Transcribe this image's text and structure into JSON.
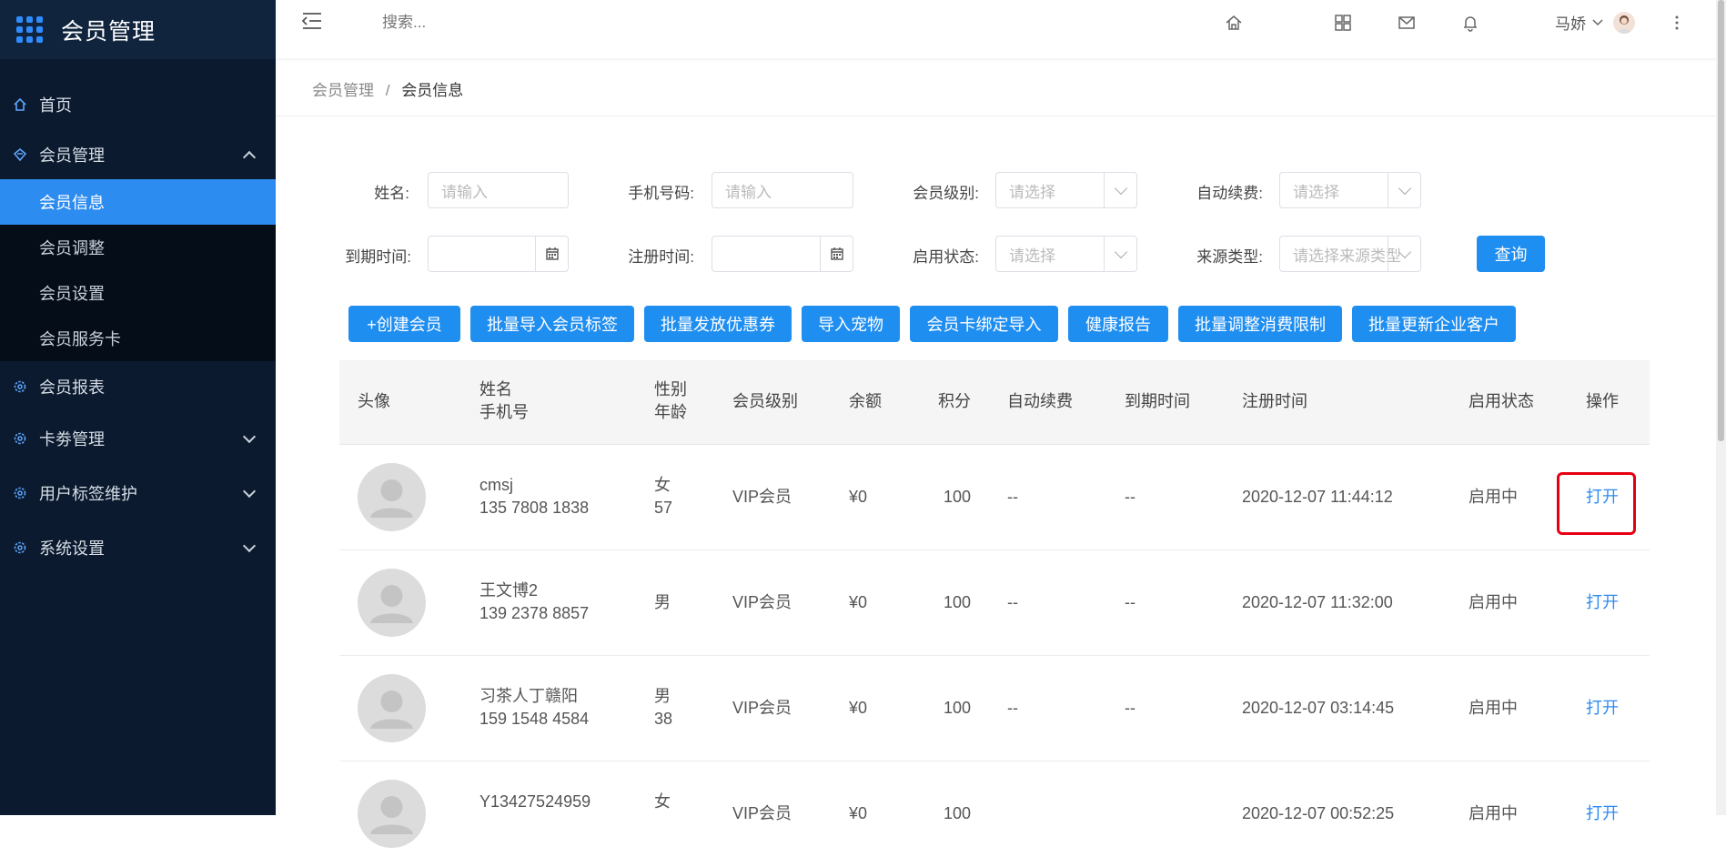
{
  "app": {
    "title": "会员管理"
  },
  "sidebar": {
    "home": "首页",
    "member_mgmt": "会员管理",
    "sub": [
      "会员信息",
      "会员调整",
      "会员设置",
      "会员服务卡"
    ],
    "reports": "会员报表",
    "coupons": "卡劵管理",
    "tags": "用户标签维护",
    "settings": "系统设置"
  },
  "header": {
    "search_placeholder": "搜索...",
    "user_name": "马娇"
  },
  "breadcrumb": {
    "root": "会员管理",
    "sep": "/",
    "current": "会员信息"
  },
  "filters": {
    "name_label": "姓名:",
    "name_placeholder": "请输入",
    "phone_label": "手机号码:",
    "phone_placeholder": "请输入",
    "level_label": "会员级别:",
    "level_placeholder": "请选择",
    "renew_label": "自动续费:",
    "renew_placeholder": "请选择",
    "expire_label": "到期时间:",
    "register_label": "注册时间:",
    "status_label": "启用状态:",
    "status_placeholder": "请选择",
    "source_label": "来源类型:",
    "source_placeholder": "请选择来源类型",
    "query_button": "查询"
  },
  "actions": [
    "+创建会员",
    "批量导入会员标签",
    "批量发放优惠券",
    "导入宠物",
    "会员卡绑定导入",
    "健康报告",
    "批量调整消费限制",
    "批量更新企业客户"
  ],
  "table": {
    "headers": {
      "avatar": "头像",
      "name": "姓名",
      "phone": "手机号",
      "gender": "性别",
      "age": "年龄",
      "level": "会员级别",
      "balance": "余额",
      "points": "积分",
      "auto_renew": "自动续费",
      "expire": "到期时间",
      "register": "注册时间",
      "status": "启用状态",
      "action": "操作"
    },
    "rows": [
      {
        "name": "cmsj",
        "phone": "135 7808 1838",
        "gender": "女",
        "age": "57",
        "level": "VIP会员",
        "balance": "¥0",
        "points": "100",
        "auto_renew": "--",
        "expire": "--",
        "register": "2020-12-07 11:44:12",
        "status": "启用中",
        "action": "打开"
      },
      {
        "name": "王文博2",
        "phone": "139 2378 8857",
        "gender": "男",
        "age": "",
        "level": "VIP会员",
        "balance": "¥0",
        "points": "100",
        "auto_renew": "--",
        "expire": "--",
        "register": "2020-12-07 11:32:00",
        "status": "启用中",
        "action": "打开"
      },
      {
        "name": "习茶人丁赣阳",
        "phone": "159 1548 4584",
        "gender": "男",
        "age": "38",
        "level": "VIP会员",
        "balance": "¥0",
        "points": "100",
        "auto_renew": "--",
        "expire": "--",
        "register": "2020-12-07 03:14:45",
        "status": "启用中",
        "action": "打开"
      },
      {
        "name": "Y13427524959",
        "phone": "",
        "gender": "女",
        "age": "",
        "level": "VIP会员",
        "balance": "¥0",
        "points": "100",
        "auto_renew": "",
        "expire": "",
        "register": "2020-12-07 00:52:25",
        "status": "启用中",
        "action": "打开"
      }
    ]
  },
  "colors": {
    "primary": "#1f8ef1",
    "sidebar_bg": "#0b1a2e",
    "highlight": "#e60012"
  }
}
